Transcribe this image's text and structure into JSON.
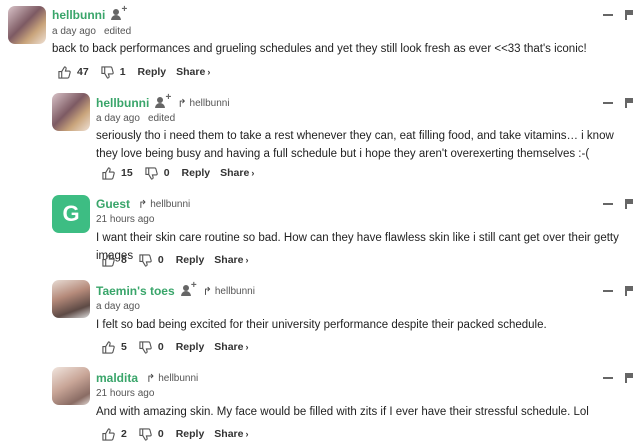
{
  "comments": [
    {
      "user": "hellbunni",
      "time": "a day ago",
      "edited": "edited",
      "text": "back to back performances and grueling schedules and yet they still look fresh as ever <<33 that's iconic!",
      "likes": "47",
      "dislikes": "1",
      "reply": "Reply",
      "share": "Share"
    },
    {
      "user": "hellbunni",
      "reply_to": "hellbunni",
      "time": "a day ago",
      "edited": "edited",
      "text": "seriously tho i need them to take a rest whenever they can, eat filling food, and take vitamins… i know they love being busy and having a full schedule but i hope they aren't overexerting themselves :-(",
      "likes": "15",
      "dislikes": "0",
      "reply": "Reply",
      "share": "Share"
    },
    {
      "user": "Guest",
      "avatar_letter": "G",
      "reply_to": "hellbunni",
      "time": "21 hours ago",
      "text": "I want their skin care routine so bad. How can they have flawless skin like i still cant get over their getty images",
      "likes": "8",
      "dislikes": "0",
      "reply": "Reply",
      "share": "Share"
    },
    {
      "user": "Taemin's toes",
      "reply_to": "hellbunni",
      "time": "a day ago",
      "text": "I felt so bad being excited for their university performance despite their packed schedule.",
      "likes": "5",
      "dislikes": "0",
      "reply": "Reply",
      "share": "Share"
    },
    {
      "user": "maldita",
      "reply_to": "hellbunni",
      "time": "21 hours ago",
      "text": "And with amazing skin. My face would be filled with zits if I ever have their stressful schedule. Lol",
      "likes": "2",
      "dislikes": "0",
      "reply": "Reply",
      "share": "Share"
    }
  ],
  "chevron": "›",
  "reply_arrow": "↱",
  "colors": {
    "username": "#39a56a",
    "guest_avatar": "#3dbd83",
    "text": "#222222",
    "icon": "#666666"
  }
}
